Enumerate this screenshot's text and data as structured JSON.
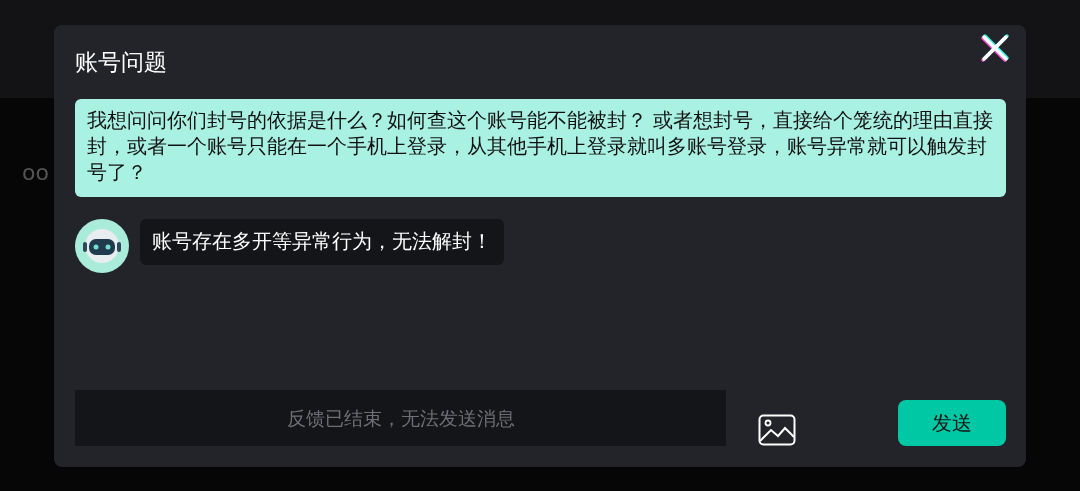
{
  "background": {
    "side_text": "oo"
  },
  "dialog": {
    "title": "账号问题"
  },
  "messages": [
    {
      "kind": "user",
      "text": "我想问问你们封号的依据是什么？如何查这个账号能不能被封？ 或者想封号，直接给个笼统的理由直接封，或者一个账号只能在一个手机上登录，从其他手机上登录就叫多账号登录，账号异常就可以触发封号了？"
    },
    {
      "kind": "bot",
      "text": "账号存在多开等异常行为，无法解封！"
    }
  ],
  "composer": {
    "placeholder": "反馈已结束，无法发送消息",
    "disabled": true,
    "send_label": "发送"
  }
}
